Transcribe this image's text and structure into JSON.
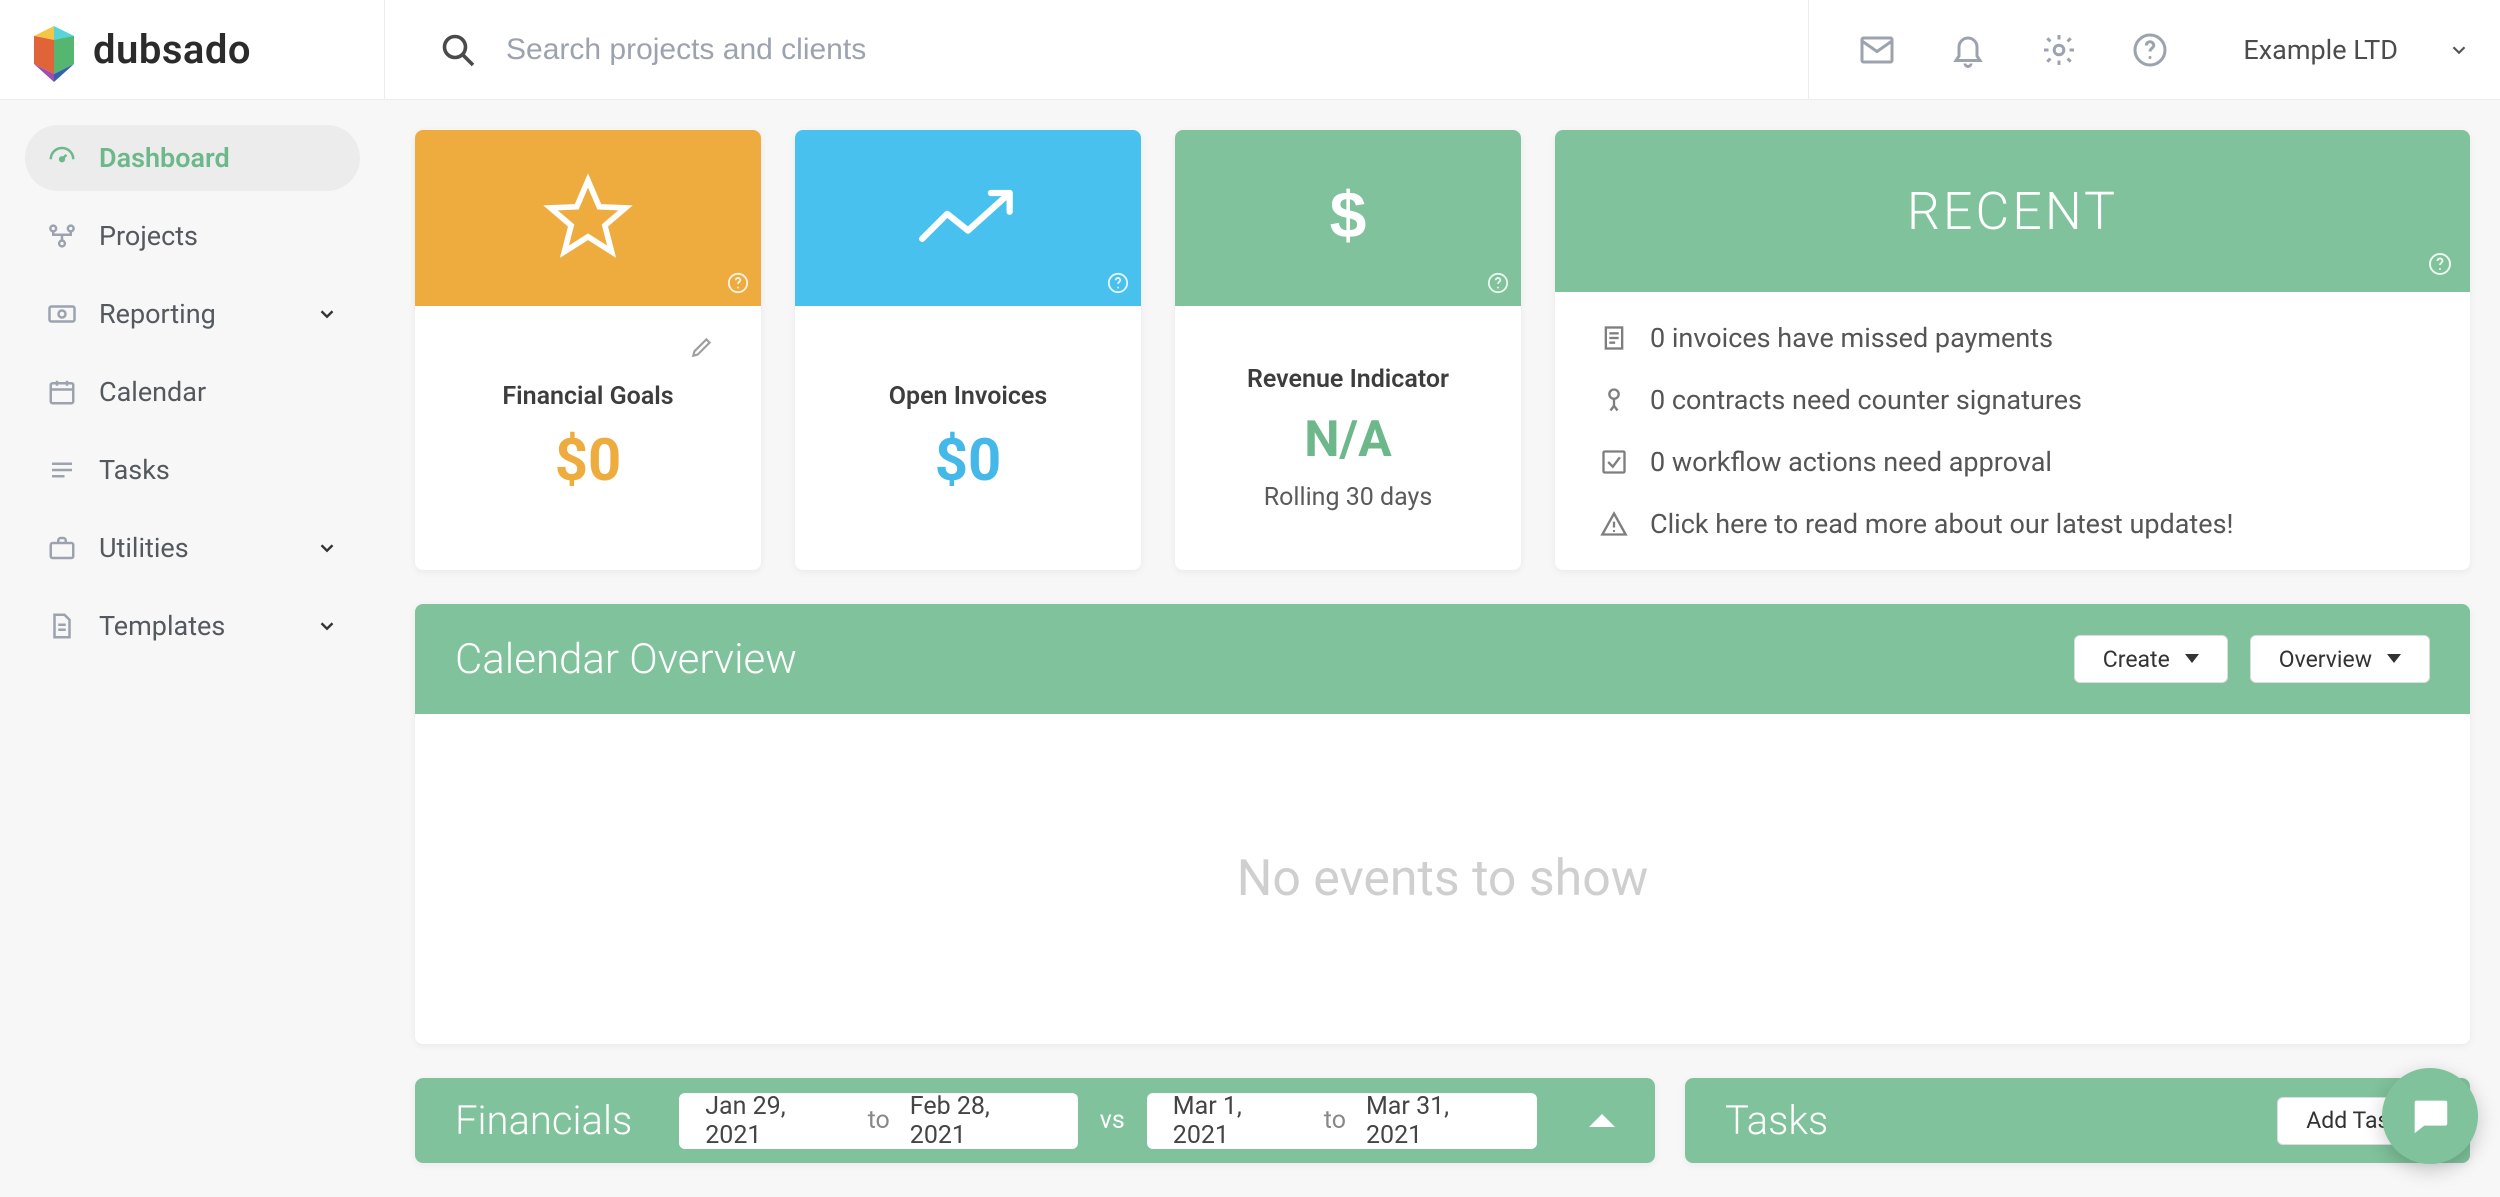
{
  "app": {
    "name": "dubsado"
  },
  "search": {
    "placeholder": "Search projects and clients"
  },
  "account": {
    "brand": "Example LTD"
  },
  "sidebar": {
    "items": [
      {
        "label": "Dashboard"
      },
      {
        "label": "Projects"
      },
      {
        "label": "Reporting"
      },
      {
        "label": "Calendar"
      },
      {
        "label": "Tasks"
      },
      {
        "label": "Utilities"
      },
      {
        "label": "Templates"
      }
    ]
  },
  "stats": {
    "goals": {
      "title": "Financial Goals",
      "value": "$0"
    },
    "invoices": {
      "title": "Open Invoices",
      "value": "$0"
    },
    "revenue": {
      "title": "Revenue Indicator",
      "value": "N/A",
      "sub": "Rolling 30 days"
    }
  },
  "recent": {
    "title": "RECENT",
    "items": [
      "0 invoices have missed payments",
      "0 contracts need counter signatures",
      "0 workflow actions need approval",
      "Click here to read more about our latest updates!"
    ]
  },
  "calendar": {
    "title": "Calendar Overview",
    "create": "Create",
    "overview": "Overview",
    "empty": "No events to show"
  },
  "financials": {
    "title": "Financials",
    "range1_from": "Jan 29, 2021",
    "range1_to_label": "to",
    "range1_to": "Feb 28, 2021",
    "vs": "vs",
    "range2_from": "Mar 1, 2021",
    "range2_to_label": "to",
    "range2_to": "Mar 31, 2021"
  },
  "tasks": {
    "title": "Tasks",
    "add": "Add Task"
  }
}
